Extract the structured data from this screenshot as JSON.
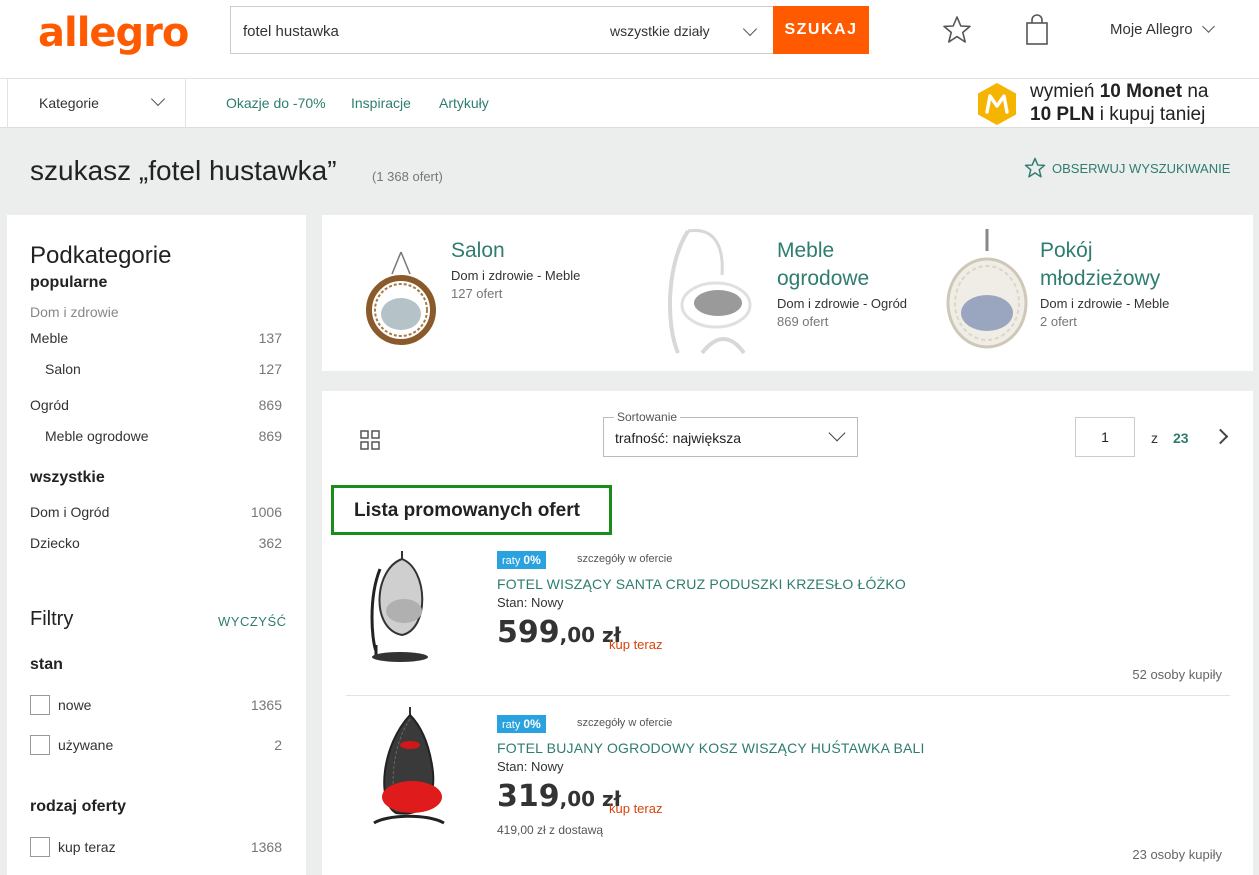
{
  "header": {
    "logo": "allegro",
    "search_value": "fotel hustawka",
    "department": "wszystkie działy",
    "search_button": "SZUKAJ",
    "account": "Moje Allegro"
  },
  "nav": {
    "categories": "Kategorie",
    "links": [
      "Okazje do -70%",
      "Inspiracje",
      "Artykuły"
    ],
    "promo_prefix": "wymień",
    "promo_bold1": "10 Monet",
    "promo_mid": "na",
    "promo_bold2": "10 PLN",
    "promo_suffix": "i kupuj taniej"
  },
  "search": {
    "title": "szukasz „fotel hustawka”",
    "count": "(1 368 ofert)",
    "observe": "OBSERWUJ WYSZUKIWANIE"
  },
  "sidebar": {
    "subcategories_title": "Podkategorie",
    "popular_title": "popularne",
    "popular_group": "Dom i zdrowie",
    "popular": [
      {
        "label": "Meble",
        "count": "137",
        "indent": false
      },
      {
        "label": "Salon",
        "count": "127",
        "indent": true
      },
      {
        "label": "Ogród",
        "count": "869",
        "indent": false
      },
      {
        "label": "Meble ogrodowe",
        "count": "869",
        "indent": true
      }
    ],
    "all_title": "wszystkie",
    "all": [
      {
        "label": "Dom i Ogród",
        "count": "1006"
      },
      {
        "label": "Dziecko",
        "count": "362"
      }
    ],
    "filters_title": "Filtry",
    "clear": "WYCZYŚĆ",
    "condition_title": "stan",
    "condition": [
      {
        "label": "nowe",
        "count": "1365"
      },
      {
        "label": "używane",
        "count": "2"
      }
    ],
    "offer_type_title": "rodzaj oferty",
    "offer_type": [
      {
        "label": "kup teraz",
        "count": "1368"
      }
    ]
  },
  "category_cards": [
    {
      "name_line1": "Salon",
      "name_line2": "",
      "path": "Dom i zdrowie - Meble",
      "count": "127 ofert"
    },
    {
      "name_line1": "Meble",
      "name_line2": "ogrodowe",
      "path": "Dom i zdrowie - Ogród",
      "count": "869 ofert"
    },
    {
      "name_line1": "Pokój",
      "name_line2": "młodzieżowy",
      "path": "Dom i zdrowie - Meble",
      "count": "2 ofert"
    }
  ],
  "listing": {
    "sort_legend": "Sortowanie",
    "sort_value": "trafność: największa",
    "page": "1",
    "page_of": "z",
    "page_total": "23",
    "promoted_label": "Lista promowanych ofert",
    "offers": [
      {
        "raty": "raty",
        "raty_pct": "0%",
        "raty_note": "szczegóły w ofercie",
        "title": "FOTEL WISZĄCY SANTA CRUZ PODUSZKI KRZESŁO ŁÓŻKO",
        "condition": "Stan: Nowy",
        "price_main": "599",
        "price_cents": ",00 zł",
        "buy": "kup teraz",
        "delivery": "",
        "sold": "52 osoby kupiły"
      },
      {
        "raty": "raty",
        "raty_pct": "0%",
        "raty_note": "szczegóły w ofercie",
        "title": "FOTEL BUJANY OGRODOWY KOSZ WISZĄCY HUŚTAWKA BALI",
        "condition": "Stan: Nowy",
        "price_main": "319",
        "price_cents": ",00 zł",
        "buy": "kup teraz",
        "delivery": "419,00 zł z dostawą",
        "sold": "23 osoby kupiły"
      }
    ]
  },
  "colors": {
    "brand": "#ff5a00",
    "link": "#2e7d6e",
    "promo_border": "#1a8c1a",
    "raty": "#2ba2e0"
  }
}
